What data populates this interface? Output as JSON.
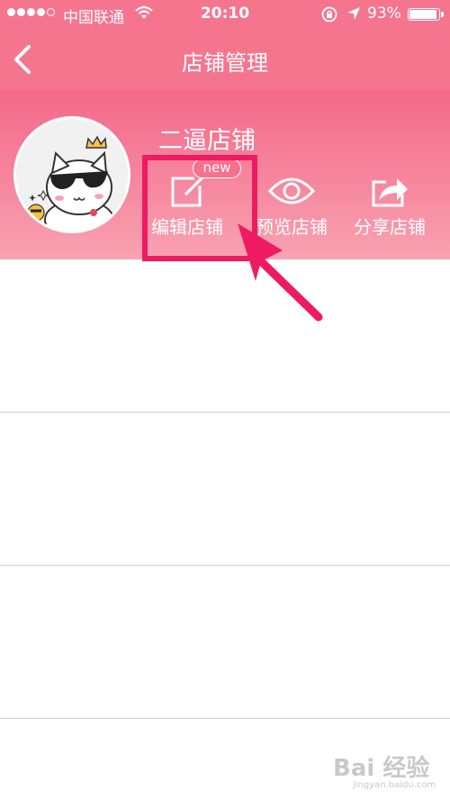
{
  "status_bar": {
    "carrier": "中国联通",
    "time": "20:10",
    "battery": "93%",
    "battery_level": 0.93
  },
  "nav": {
    "title": "店铺管理",
    "back_icon": "chevron-left-icon"
  },
  "shop": {
    "name": "二逼店铺",
    "avatar_icon": "cat-with-sunglasses-avatar"
  },
  "actions": [
    {
      "label": "编辑店铺",
      "icon": "edit-icon",
      "badge": "new"
    },
    {
      "label": "预览店铺",
      "icon": "eye-icon"
    },
    {
      "label": "分享店铺",
      "icon": "share-icon"
    }
  ],
  "watermark": {
    "text": "Bai 经验",
    "url": "jingyan.baidu.com"
  },
  "colors": {
    "brand": "#f5758f",
    "highlight": "#ee1b63"
  }
}
